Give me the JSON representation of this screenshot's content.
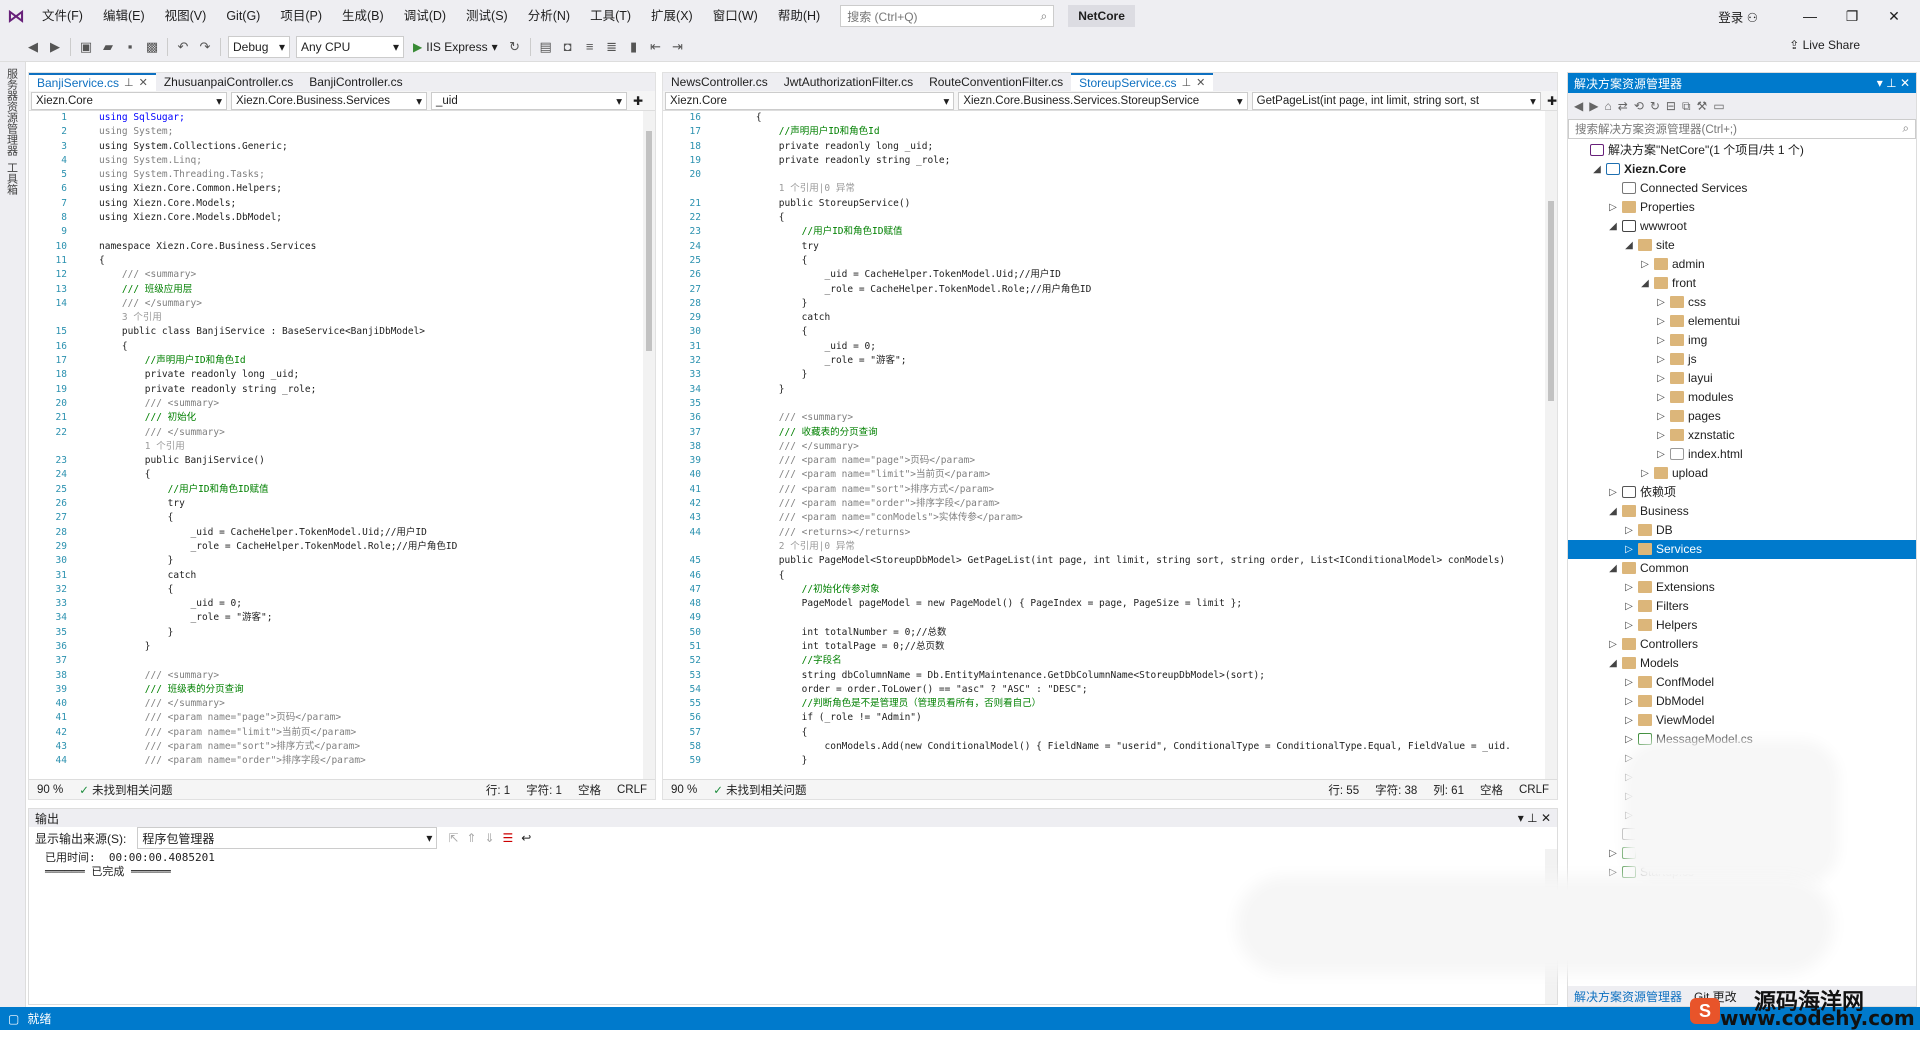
{
  "menubar": {
    "items": [
      "文件(F)",
      "编辑(E)",
      "视图(V)",
      "Git(G)",
      "项目(P)",
      "生成(B)",
      "调试(D)",
      "测试(S)",
      "分析(N)",
      "工具(T)",
      "扩展(X)",
      "窗口(W)",
      "帮助(H)"
    ],
    "search_placeholder": "搜索 (Ctrl+Q)",
    "solution_name": "NetCore",
    "login": "登录"
  },
  "toolbar": {
    "config": "Debug",
    "platform": "Any CPU",
    "run_label": "IIS Express",
    "live_share": "Live Share"
  },
  "left_strip": {
    "tabs": [
      "服务器资源管理器",
      "工具箱"
    ]
  },
  "left_editor": {
    "tabs": [
      {
        "label": "BanjiService.cs",
        "active": true
      },
      {
        "label": "ZhusuanpaiController.cs"
      },
      {
        "label": "BanjiController.cs"
      }
    ],
    "nav": [
      "Xiezn.Core",
      "Xiezn.Core.Business.Services",
      "_uid"
    ],
    "lines": [
      [
        1,
        "using SqlSugar;",
        "kw"
      ],
      [
        2,
        "using System;",
        "gr"
      ],
      [
        3,
        "using System.Collections.Generic;",
        ""
      ],
      [
        4,
        "using System.Linq;",
        "gr"
      ],
      [
        5,
        "using System.Threading.Tasks;",
        "gr"
      ],
      [
        6,
        "using Xiezn.Core.Common.Helpers;",
        ""
      ],
      [
        7,
        "using Xiezn.Core.Models;",
        ""
      ],
      [
        8,
        "using Xiezn.Core.Models.DbModel;",
        ""
      ],
      [
        9,
        "",
        ""
      ],
      [
        10,
        "namespace Xiezn.Core.Business.Services",
        ""
      ],
      [
        11,
        "{",
        ""
      ],
      [
        12,
        "    /// <summary>",
        "gr"
      ],
      [
        13,
        "    /// 班级应用层",
        "cm"
      ],
      [
        14,
        "    /// </summary>",
        "gr"
      ],
      [
        0,
        "    3 个引用",
        "ref"
      ],
      [
        15,
        "    public class BanjiService : BaseService<BanjiDbModel>",
        ""
      ],
      [
        16,
        "    {",
        ""
      ],
      [
        17,
        "        //声明用户ID和角色Id",
        "cm"
      ],
      [
        18,
        "        private readonly long _uid;",
        ""
      ],
      [
        19,
        "        private readonly string _role;",
        ""
      ],
      [
        20,
        "        /// <summary>",
        "gr"
      ],
      [
        21,
        "        /// 初始化",
        "cm"
      ],
      [
        22,
        "        /// </summary>",
        "gr"
      ],
      [
        0,
        "        1 个引用",
        "ref"
      ],
      [
        23,
        "        public BanjiService()",
        ""
      ],
      [
        24,
        "        {",
        ""
      ],
      [
        25,
        "            //用户ID和角色ID赋值",
        "cm"
      ],
      [
        26,
        "            try",
        ""
      ],
      [
        27,
        "            {",
        ""
      ],
      [
        28,
        "                _uid = CacheHelper.TokenModel.Uid;//用户ID",
        ""
      ],
      [
        29,
        "                _role = CacheHelper.TokenModel.Role;//用户角色ID",
        ""
      ],
      [
        30,
        "            }",
        ""
      ],
      [
        31,
        "            catch",
        ""
      ],
      [
        32,
        "            {",
        ""
      ],
      [
        33,
        "                _uid = 0;",
        ""
      ],
      [
        34,
        "                _role = \"游客\";",
        ""
      ],
      [
        35,
        "            }",
        ""
      ],
      [
        36,
        "        }",
        ""
      ],
      [
        37,
        "",
        ""
      ],
      [
        38,
        "        /// <summary>",
        "gr"
      ],
      [
        39,
        "        /// 班级表的分页查询",
        "cm"
      ],
      [
        40,
        "        /// </summary>",
        "gr"
      ],
      [
        41,
        "        /// <param name=\"page\">页码</param>",
        "gr"
      ],
      [
        42,
        "        /// <param name=\"limit\">当前页</param>",
        "gr"
      ],
      [
        43,
        "        /// <param name=\"sort\">排序方式</param>",
        "gr"
      ],
      [
        44,
        "        /// <param name=\"order\">排序字段</param>",
        "gr"
      ]
    ],
    "status": {
      "zoom": "90 %",
      "issues": "未找到相关问题",
      "row": "行: 1",
      "char": "字符: 1",
      "spaces": "空格",
      "eol": "CRLF"
    }
  },
  "right_editor": {
    "tabs": [
      {
        "label": "NewsController.cs"
      },
      {
        "label": "JwtAuthorizationFilter.cs"
      },
      {
        "label": "RouteConventionFilter.cs"
      },
      {
        "label": "StoreupService.cs",
        "active": true
      }
    ],
    "nav": [
      "Xiezn.Core",
      "Xiezn.Core.Business.Services.StoreupService",
      "GetPageList(int page, int limit, string sort, st"
    ],
    "lines": [
      [
        16,
        "    {",
        ""
      ],
      [
        17,
        "        //声明用户ID和角色Id",
        "cm"
      ],
      [
        18,
        "        private readonly long _uid;",
        ""
      ],
      [
        19,
        "        private readonly string _role;",
        ""
      ],
      [
        20,
        "",
        ""
      ],
      [
        0,
        "        1 个引用|0 异常",
        "ref"
      ],
      [
        21,
        "        public StoreupService()",
        ""
      ],
      [
        22,
        "        {",
        ""
      ],
      [
        23,
        "            //用户ID和角色ID赋值",
        "cm"
      ],
      [
        24,
        "            try",
        ""
      ],
      [
        25,
        "            {",
        ""
      ],
      [
        26,
        "                _uid = CacheHelper.TokenModel.Uid;//用户ID",
        ""
      ],
      [
        27,
        "                _role = CacheHelper.TokenModel.Role;//用户角色ID",
        ""
      ],
      [
        28,
        "            }",
        ""
      ],
      [
        29,
        "            catch",
        ""
      ],
      [
        30,
        "            {",
        ""
      ],
      [
        31,
        "                _uid = 0;",
        ""
      ],
      [
        32,
        "                _role = \"游客\";",
        ""
      ],
      [
        33,
        "            }",
        ""
      ],
      [
        34,
        "        }",
        ""
      ],
      [
        35,
        "",
        ""
      ],
      [
        36,
        "        /// <summary>",
        "gr"
      ],
      [
        37,
        "        /// 收藏表的分页查询",
        "cm"
      ],
      [
        38,
        "        /// </summary>",
        "gr"
      ],
      [
        39,
        "        /// <param name=\"page\">页码</param>",
        "gr"
      ],
      [
        40,
        "        /// <param name=\"limit\">当前页</param>",
        "gr"
      ],
      [
        41,
        "        /// <param name=\"sort\">排序方式</param>",
        "gr"
      ],
      [
        42,
        "        /// <param name=\"order\">排序字段</param>",
        "gr"
      ],
      [
        43,
        "        /// <param name=\"conModels\">实体传参</param>",
        "gr"
      ],
      [
        44,
        "        /// <returns></returns>",
        "gr"
      ],
      [
        0,
        "        2 个引用|0 异常",
        "ref"
      ],
      [
        45,
        "        public PageModel<StoreupDbModel> GetPageList(int page, int limit, string sort, string order, List<IConditionalModel> conModels)",
        ""
      ],
      [
        46,
        "        {",
        ""
      ],
      [
        47,
        "            //初始化传参对象",
        "cm"
      ],
      [
        48,
        "            PageModel pageModel = new PageModel() { PageIndex = page, PageSize = limit };",
        ""
      ],
      [
        49,
        "",
        ""
      ],
      [
        50,
        "            int totalNumber = 0;//总数",
        ""
      ],
      [
        51,
        "            int totalPage = 0;//总页数",
        ""
      ],
      [
        52,
        "            //字段名",
        "cm"
      ],
      [
        53,
        "            string dbColumnName = Db.EntityMaintenance.GetDbColumnName<StoreupDbModel>(sort);",
        ""
      ],
      [
        54,
        "            order = order.ToLower() == \"asc\" ? \"ASC\" : \"DESC\";",
        ""
      ],
      [
        55,
        "            //判断角色是不是管理员（管理员看所有，否则看自己）",
        "cm"
      ],
      [
        56,
        "            if (_role != \"Admin\")",
        ""
      ],
      [
        57,
        "            {",
        ""
      ],
      [
        58,
        "                conModels.Add(new ConditionalModel() { FieldName = \"userid\", ConditionalType = ConditionalType.Equal, FieldValue = _uid.",
        ""
      ],
      [
        59,
        "            }",
        ""
      ]
    ],
    "status": {
      "zoom": "90 %",
      "issues": "未找到相关问题",
      "row": "行: 55",
      "char": "字符: 38",
      "col": "列: 61",
      "spaces": "空格",
      "eol": "CRLF"
    }
  },
  "output": {
    "title": "输出",
    "source_label": "显示输出来源(S):",
    "source": "程序包管理器",
    "time_line": "已用时间:  00:00:00.4085201",
    "done": "已完成"
  },
  "solution_explorer": {
    "title": "解决方案资源管理器",
    "search_placeholder": "搜索解决方案资源管理器(Ctrl+;)",
    "items": [
      {
        "label": "解决方案\"NetCore\"(1 个项目/共 1 个)",
        "level": 0,
        "arrow": "",
        "icon": "solution"
      },
      {
        "label": "Xiezn.Core",
        "level": 1,
        "arrow": "◢",
        "icon": "project",
        "bold": true
      },
      {
        "label": "Connected Services",
        "level": 2,
        "arrow": "",
        "icon": "service"
      },
      {
        "label": "Properties",
        "level": 2,
        "arrow": "▷",
        "icon": "folder"
      },
      {
        "label": "wwwroot",
        "level": 2,
        "arrow": "◢",
        "icon": "globe"
      },
      {
        "label": "site",
        "level": 3,
        "arrow": "◢",
        "icon": "folder"
      },
      {
        "label": "admin",
        "level": 4,
        "arrow": "▷",
        "icon": "folder"
      },
      {
        "label": "front",
        "level": 4,
        "arrow": "◢",
        "icon": "folder"
      },
      {
        "label": "css",
        "level": 5,
        "arrow": "▷",
        "icon": "folder"
      },
      {
        "label": "elementui",
        "level": 5,
        "arrow": "▷",
        "icon": "folder"
      },
      {
        "label": "img",
        "level": 5,
        "arrow": "▷",
        "icon": "folder"
      },
      {
        "label": "js",
        "level": 5,
        "arrow": "▷",
        "icon": "folder"
      },
      {
        "label": "layui",
        "level": 5,
        "arrow": "▷",
        "icon": "folder"
      },
      {
        "label": "modules",
        "level": 5,
        "arrow": "▷",
        "icon": "folder"
      },
      {
        "label": "pages",
        "level": 5,
        "arrow": "▷",
        "icon": "folder"
      },
      {
        "label": "xznstatic",
        "level": 5,
        "arrow": "▷",
        "icon": "folder"
      },
      {
        "label": "index.html",
        "level": 5,
        "arrow": "▷",
        "icon": "file"
      },
      {
        "label": "upload",
        "level": 4,
        "arrow": "▷",
        "icon": "folder"
      },
      {
        "label": "依赖项",
        "level": 2,
        "arrow": "▷",
        "icon": "deps"
      },
      {
        "label": "Business",
        "level": 2,
        "arrow": "◢",
        "icon": "folder"
      },
      {
        "label": "DB",
        "level": 3,
        "arrow": "▷",
        "icon": "folder"
      },
      {
        "label": "Services",
        "level": 3,
        "arrow": "▷",
        "icon": "folder",
        "selected": true
      },
      {
        "label": "Common",
        "level": 2,
        "arrow": "◢",
        "icon": "folder"
      },
      {
        "label": "Extensions",
        "level": 3,
        "arrow": "▷",
        "icon": "folder"
      },
      {
        "label": "Filters",
        "level": 3,
        "arrow": "▷",
        "icon": "folder"
      },
      {
        "label": "Helpers",
        "level": 3,
        "arrow": "▷",
        "icon": "folder"
      },
      {
        "label": "Controllers",
        "level": 2,
        "arrow": "▷",
        "icon": "folder"
      },
      {
        "label": "Models",
        "level": 2,
        "arrow": "◢",
        "icon": "folder"
      },
      {
        "label": "ConfModel",
        "level": 3,
        "arrow": "▷",
        "icon": "folder"
      },
      {
        "label": "DbModel",
        "level": 3,
        "arrow": "▷",
        "icon": "folder"
      },
      {
        "label": "ViewModel",
        "level": 3,
        "arrow": "▷",
        "icon": "folder"
      },
      {
        "label": "MessageModel.cs",
        "level": 3,
        "arrow": "▷",
        "icon": "cs"
      },
      {
        "label": "",
        "level": 3,
        "arrow": "▷",
        "icon": ""
      },
      {
        "label": "",
        "level": 3,
        "arrow": "▷",
        "icon": ""
      },
      {
        "label": "",
        "level": 3,
        "arrow": "▷",
        "icon": ""
      },
      {
        "label": "",
        "level": 3,
        "arrow": "▷",
        "icon": ""
      },
      {
        "label": "",
        "level": 2,
        "arrow": "",
        "icon": "file"
      },
      {
        "label": "Prog",
        "level": 2,
        "arrow": "▷",
        "icon": "cs"
      },
      {
        "label": "Startup.cs",
        "level": 2,
        "arrow": "▷",
        "icon": "cs"
      }
    ],
    "bottom_tabs": [
      "解决方案资源管理器",
      "Git 更改"
    ]
  },
  "statusbar": {
    "text": "就绪"
  },
  "watermark": {
    "title": "源码海洋网",
    "url": "www.codehy.com"
  }
}
